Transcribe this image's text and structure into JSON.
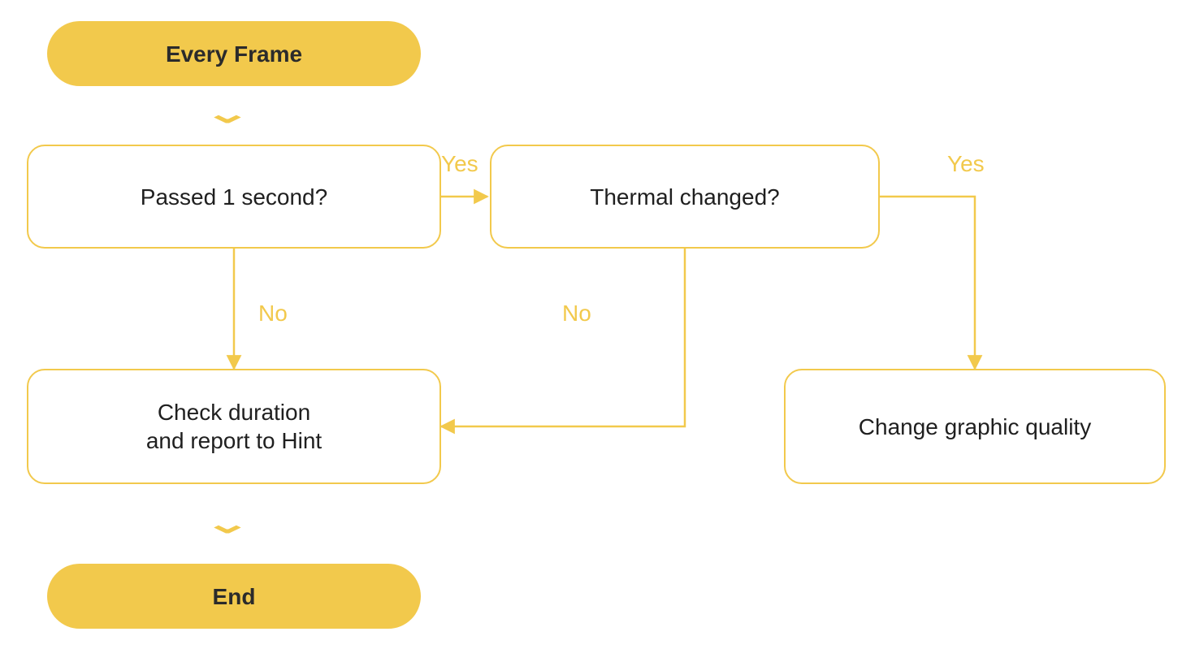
{
  "colors": {
    "accent": "#f2c94c",
    "text_dark": "#2b2b2b",
    "text_body": "#1f1f1f",
    "bg": "#ffffff"
  },
  "nodes": {
    "start": {
      "label": "Every Frame",
      "type": "terminator"
    },
    "passed1s": {
      "label": "Passed 1 second?",
      "type": "decision"
    },
    "thermal": {
      "label": "Thermal changed?",
      "type": "decision"
    },
    "check_hint": {
      "label": "Check duration\nand report to Hint",
      "type": "process"
    },
    "change_gfx": {
      "label": "Change graphic quality",
      "type": "process"
    },
    "end": {
      "label": "End",
      "type": "terminator"
    }
  },
  "edges": {
    "start_to_passed1s": {
      "from": "start",
      "to": "passed1s",
      "label": ""
    },
    "passed1s_yes": {
      "from": "passed1s",
      "to": "thermal",
      "label": "Yes"
    },
    "passed1s_no": {
      "from": "passed1s",
      "to": "check_hint",
      "label": "No"
    },
    "thermal_yes": {
      "from": "thermal",
      "to": "change_gfx",
      "label": "Yes"
    },
    "thermal_no": {
      "from": "thermal",
      "to": "check_hint",
      "label": "No"
    },
    "check_to_end": {
      "from": "check_hint",
      "to": "end",
      "label": ""
    }
  },
  "flowchart_summary": "Every frame: if 1 second has passed, check whether thermal status changed; if yes change graphic quality, if no (or if 1 second has not passed) check duration and report to Hint, then End."
}
